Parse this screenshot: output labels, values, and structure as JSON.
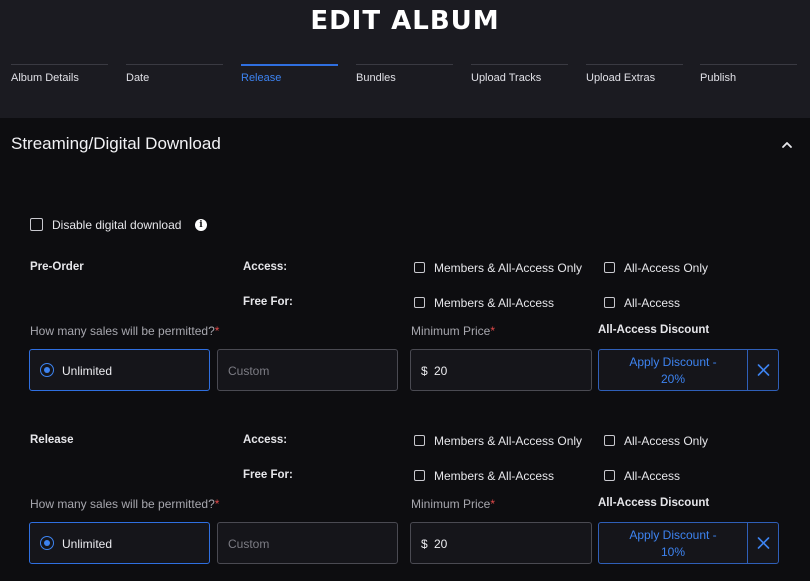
{
  "header": {
    "title": "EDIT ALBUM",
    "steps": [
      {
        "label": "Album Details"
      },
      {
        "label": "Date"
      },
      {
        "label": "Release",
        "active": true
      },
      {
        "label": "Bundles"
      },
      {
        "label": "Upload Tracks"
      },
      {
        "label": "Upload Extras"
      },
      {
        "label": "Publish"
      }
    ]
  },
  "section": {
    "title": "Streaming/Digital Download",
    "toggle_icon": "chevron-up-icon",
    "disable_download_label": "Disable digital download",
    "info_icon": "info-icon",
    "info_glyph": "i"
  },
  "preorder": {
    "heading": "Pre-Order",
    "access_label": "Access:",
    "access_options": [
      "Members & All-Access Only",
      "All-Access Only"
    ],
    "free_for_label": "Free For:",
    "free_for_options": [
      "Members & All-Access",
      "All-Access"
    ],
    "sales_question": "How many sales will be permitted?",
    "required_mark": "*",
    "unlimited_label": "Unlimited",
    "custom_placeholder": "Custom",
    "min_price_label": "Minimum Price",
    "currency": "$",
    "min_price_value": "20",
    "discount_label": "All-Access Discount",
    "apply_discount_line1": "Apply Discount -",
    "apply_discount_line2": "20%"
  },
  "release": {
    "heading": "Release",
    "access_label": "Access:",
    "access_options": [
      "Members & All-Access Only",
      "All-Access Only"
    ],
    "free_for_label": "Free For:",
    "free_for_options": [
      "Members & All-Access",
      "All-Access"
    ],
    "sales_question": "How many sales will be permitted?",
    "required_mark": "*",
    "unlimited_label": "Unlimited",
    "custom_placeholder": "Custom",
    "min_price_label": "Minimum Price",
    "currency": "$",
    "min_price_value": "20",
    "discount_label": "All-Access Discount",
    "apply_discount_line1": "Apply Discount -",
    "apply_discount_line2": "10%"
  },
  "colors": {
    "accent": "#3d83f0",
    "background": "#0d0d10",
    "header_bg": "#1b1b21",
    "required": "#e04a4a"
  }
}
